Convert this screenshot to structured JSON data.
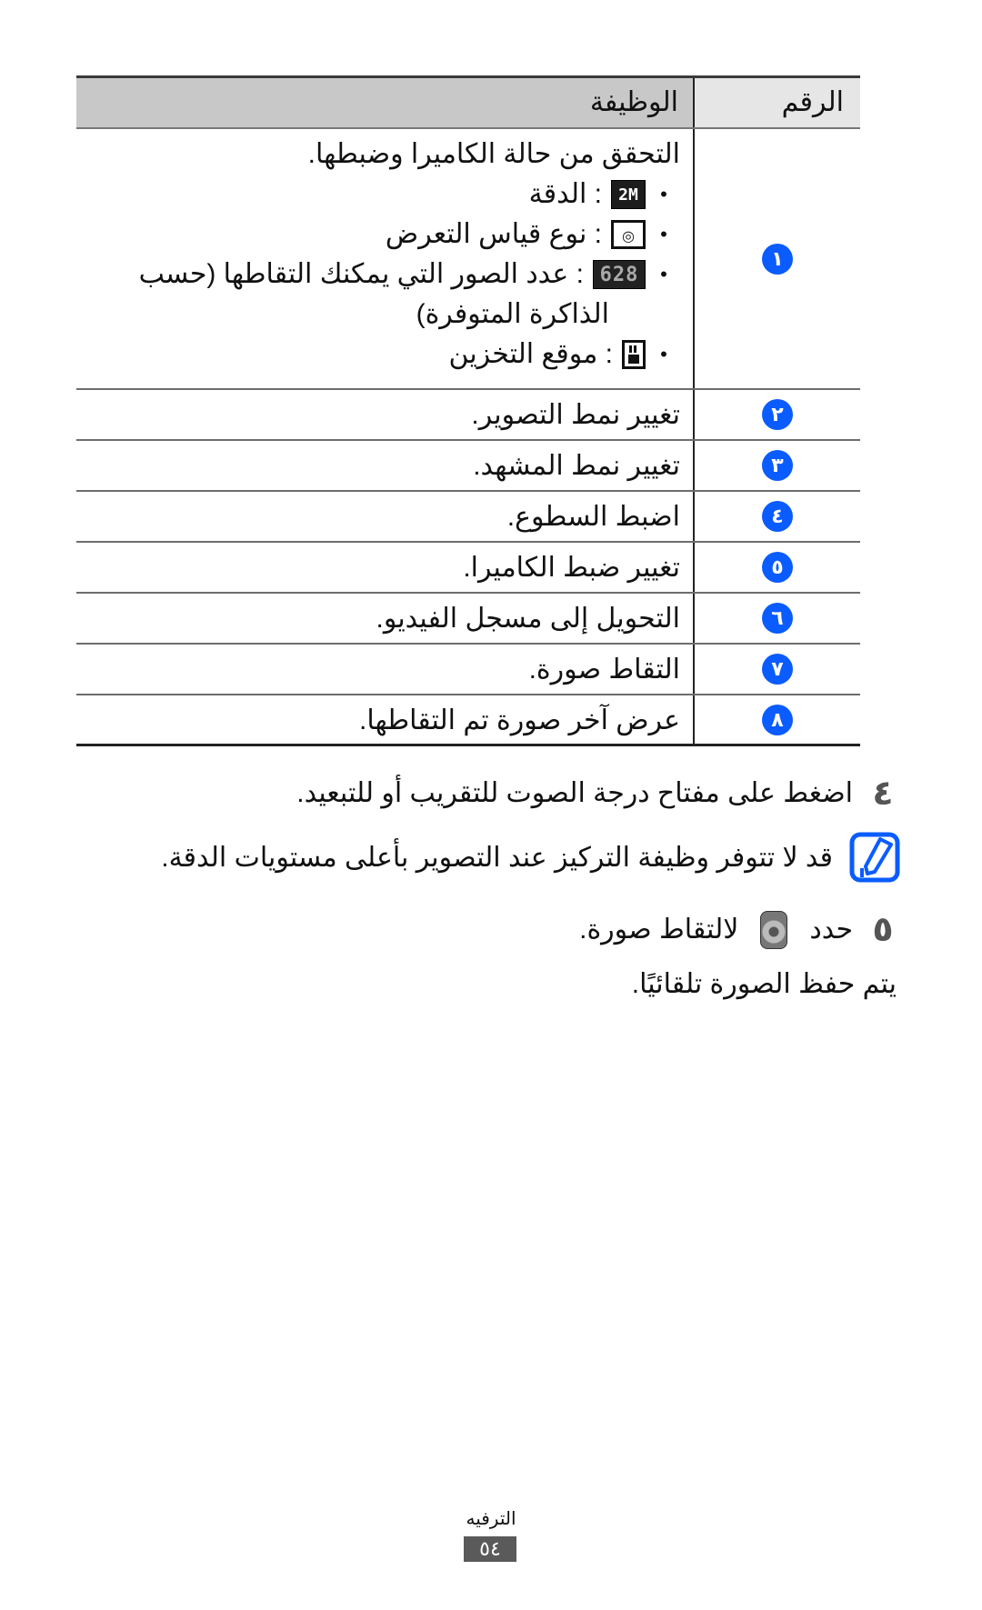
{
  "table": {
    "headers": {
      "number": "الرقم",
      "function": "الوظيفة"
    },
    "rows": [
      {
        "badge": "١",
        "title": "التحقق من حالة الكاميرا وضبطها.",
        "bullets": [
          {
            "icon": "resolution-icon",
            "icon_text": "2M",
            "text": ": الدقة"
          },
          {
            "icon": "exposure-meter-icon",
            "icon_text": "◎",
            "text": ": نوع قياس التعرض"
          },
          {
            "icon": "photo-count-icon",
            "icon_text": "628",
            "text": ": عدد الصور التي يمكنك التقاطها (حسب",
            "continuation": "الذاكرة المتوفرة)"
          },
          {
            "icon": "storage-location-icon",
            "icon_text": "",
            "text": ": موقع التخزين"
          }
        ]
      },
      {
        "badge": "٢",
        "text": "تغيير نمط التصوير."
      },
      {
        "badge": "٣",
        "text": "تغيير نمط المشهد."
      },
      {
        "badge": "٤",
        "text": "اضبط السطوع."
      },
      {
        "badge": "٥",
        "text": "تغيير ضبط الكاميرا."
      },
      {
        "badge": "٦",
        "text": "التحويل إلى مسجل الفيديو."
      },
      {
        "badge": "٧",
        "text": "التقاط صورة."
      },
      {
        "badge": "٨",
        "text": "عرض آخر صورة تم التقاطها."
      }
    ]
  },
  "steps": [
    {
      "number": "٤",
      "text": "اضغط على مفتاح درجة الصوت للتقريب أو للتبعيد."
    },
    {
      "number": "٥",
      "text_before": "حدد",
      "icon": "shutter-icon",
      "text_after": "لالتقاط صورة.",
      "subtext": "يتم حفظ الصورة تلقائيًا."
    }
  ],
  "note": {
    "icon": "note-pencil-icon",
    "text": "قد لا تتوفر وظيفة التركيز عند التصوير بأعلى مستويات الدقة."
  },
  "footer": {
    "section": "الترفيه",
    "page_number": "٥٤"
  },
  "colors": {
    "badge": "#0a5cff",
    "note_icon": "#0a5cff",
    "header_func_bg": "#c8c8c8",
    "header_num_bg": "#e6e6e6",
    "page_badge": "#5a5a5a"
  }
}
